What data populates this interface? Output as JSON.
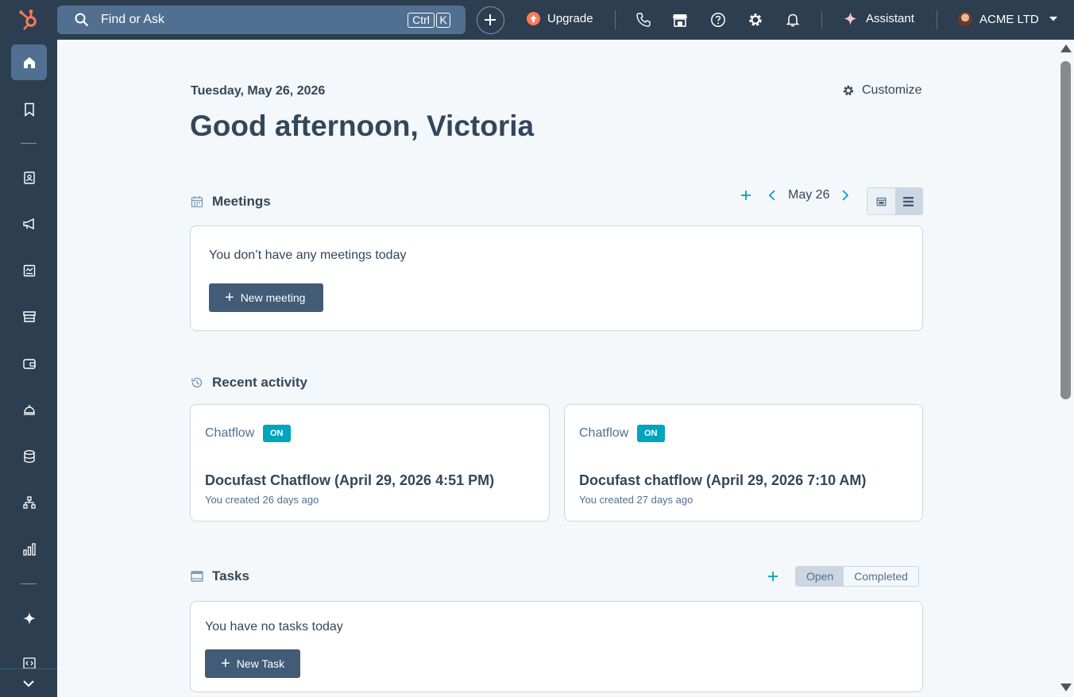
{
  "topbar": {
    "search_placeholder": "Find or Ask",
    "shortcut_ctrl": "Ctrl",
    "shortcut_key": "K",
    "upgrade_label": "Upgrade",
    "assistant_label": "Assistant",
    "account_name": "ACME LTD"
  },
  "sidebar": {
    "items": [
      "home-icon",
      "bookmark-icon",
      "contacts-icon",
      "marketing-icon",
      "content-icon",
      "commerce-icon",
      "wallet-icon",
      "service-icon",
      "data-icon",
      "automation-icon",
      "reports-icon",
      "ai-sparkle-icon",
      "developer-icon"
    ]
  },
  "header": {
    "date": "Tuesday, May 26, 2026",
    "greeting": "Good afternoon, Victoria",
    "customize_label": "Customize"
  },
  "meetings": {
    "heading": "Meetings",
    "nav_date": "May 26",
    "empty_text": "You don’t have any meetings today",
    "new_button": "New meeting"
  },
  "recent_activity": {
    "heading": "Recent activity",
    "cards": [
      {
        "type": "Chatflow",
        "badge": "ON",
        "title": "Docufast Chatflow (April 29, 2026 4:51 PM)",
        "subtitle": "You created 26 days ago"
      },
      {
        "type": "Chatflow",
        "badge": "ON",
        "title": "Docufast chatflow (April 29, 2026 7:10 AM)",
        "subtitle": "You created 27 days ago"
      }
    ]
  },
  "tasks": {
    "heading": "Tasks",
    "tabs": [
      "Open",
      "Completed"
    ],
    "empty_text": "You have no tasks today",
    "new_button": "New Task"
  },
  "colors": {
    "nav_bg": "#2d3e50",
    "accent_teal": "#00a4bd",
    "brand_orange": "#ff7a59",
    "button_dark": "#425b76"
  }
}
